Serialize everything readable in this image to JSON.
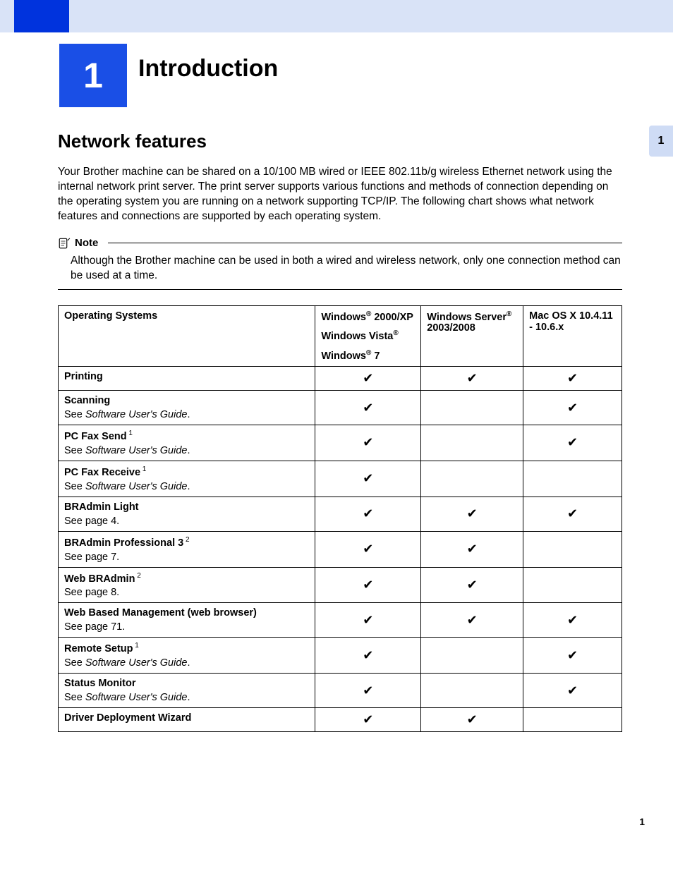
{
  "chapter": {
    "number": "1",
    "title": "Introduction"
  },
  "side_tab": "1",
  "section_title": "Network features",
  "intro": "Your Brother machine can be shared on a 10/100 MB wired or IEEE 802.11b/g wireless Ethernet network using the internal network print server. The print server supports various functions and methods of connection depending on the operating system you are running on a network supporting TCP/IP. The following chart shows what network features and connections are supported by each operating system.",
  "note": {
    "label": "Note",
    "body": "Although the Brother machine can be used in both a wired and wireless network, only one connection method can be used at a time."
  },
  "table": {
    "header": {
      "os": "Operating Systems",
      "win": {
        "l1a": "Windows",
        "l1b": " 2000/XP",
        "l2a": "Windows Vista",
        "l3a": "Windows",
        "l3b": " 7"
      },
      "srv": {
        "a": "Windows Server",
        "b": " 2003/2008"
      },
      "mac": "Mac OS X 10.4.11 - 10.6.x"
    },
    "rows": [
      {
        "name": "Printing",
        "sub": "",
        "sup": "",
        "italic": false,
        "win": true,
        "srv": true,
        "mac": true
      },
      {
        "name": "Scanning",
        "sub": "See Software User's Guide.",
        "sup": "",
        "italic": true,
        "win": true,
        "srv": false,
        "mac": true
      },
      {
        "name": "PC Fax Send",
        "sub": "See Software User's Guide.",
        "sup": "1",
        "italic": true,
        "win": true,
        "srv": false,
        "mac": true
      },
      {
        "name": "PC Fax Receive",
        "sub": "See Software User's Guide.",
        "sup": "1",
        "italic": true,
        "win": true,
        "srv": false,
        "mac": false
      },
      {
        "name": "BRAdmin Light",
        "sub": "See page 4.",
        "sup": "",
        "italic": false,
        "win": true,
        "srv": true,
        "mac": true
      },
      {
        "name": "BRAdmin Professional 3",
        "sub": "See page 7.",
        "sup": "2",
        "italic": false,
        "win": true,
        "srv": true,
        "mac": false
      },
      {
        "name": "Web BRAdmin",
        "sub": "See page 8.",
        "sup": "2",
        "italic": false,
        "win": true,
        "srv": true,
        "mac": false
      },
      {
        "name": "Web Based Management (web browser)",
        "sub": "See page 71.",
        "sup": "",
        "italic": false,
        "win": true,
        "srv": true,
        "mac": true
      },
      {
        "name": "Remote Setup",
        "sub": "See Software User's Guide.",
        "sup": "1",
        "italic": true,
        "win": true,
        "srv": false,
        "mac": true
      },
      {
        "name": "Status Monitor",
        "sub": "See Software User's Guide.",
        "sup": "",
        "italic": true,
        "win": true,
        "srv": false,
        "mac": true
      },
      {
        "name": "Driver Deployment Wizard",
        "sub": "",
        "sup": "",
        "italic": false,
        "win": true,
        "srv": true,
        "mac": false
      }
    ]
  },
  "checkmark": "✔",
  "page_number": "1",
  "reg_mark": "®"
}
